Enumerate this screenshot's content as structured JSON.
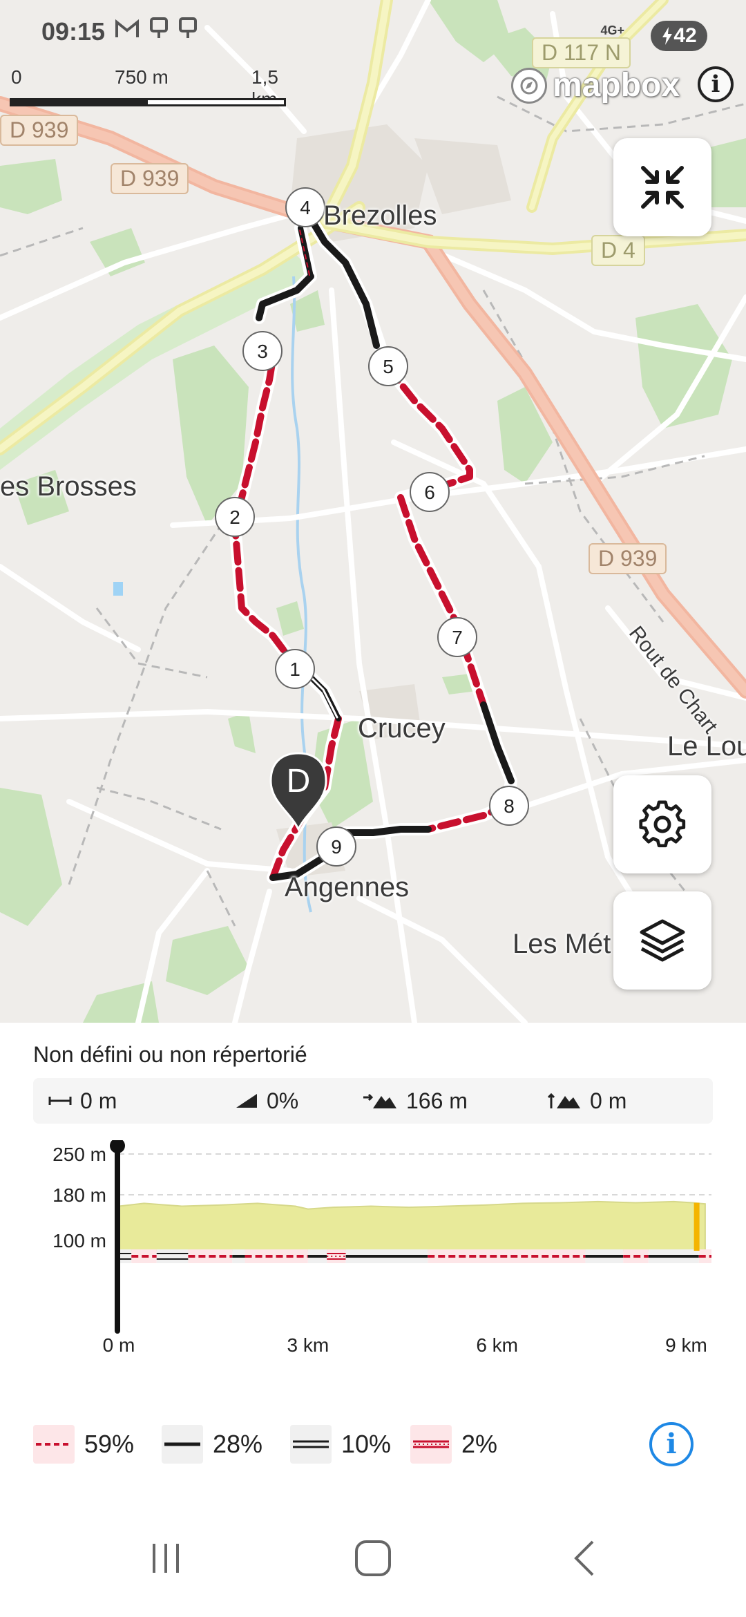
{
  "status_bar": {
    "time": "09:15",
    "network_label": "4G+",
    "battery_level": "42"
  },
  "map": {
    "scale": {
      "tick0": "0",
      "tick1": "750 m",
      "tick2": "1,5 km"
    },
    "attribution": "mapbox",
    "place_labels": {
      "brezolles": "Brezolles",
      "les_brosses": "es Brosses",
      "crucey": "Crucey",
      "angennes": "Angennes",
      "le_lou": "Le Lou",
      "les_met": "Les Mét",
      "route_de_chartres": "Rout de Chart"
    },
    "road_labels": {
      "d939_a": "D 939",
      "d939_b": "D 939",
      "d939_c": "D 939",
      "d117": "D 117 N",
      "d4": "D 4"
    },
    "waypoints": [
      "1",
      "2",
      "3",
      "4",
      "5",
      "6",
      "7",
      "8",
      "9"
    ],
    "start_marker": "D",
    "route_colors": {
      "red": "#c8102e",
      "black": "#1a1a1a",
      "outline": "#ffffff"
    }
  },
  "panel": {
    "surface_title": "Non défini ou non répertorié",
    "stats": {
      "distance": "0 m",
      "slope": "0%",
      "ascent": "166 m",
      "descent": "0 m"
    },
    "legend": [
      {
        "pct": "59%",
        "type": "dashed-red"
      },
      {
        "pct": "28%",
        "type": "solid-black"
      },
      {
        "pct": "10%",
        "type": "double-line"
      },
      {
        "pct": "2%",
        "type": "dotted-red"
      }
    ]
  },
  "chart_data": {
    "type": "area",
    "title": "",
    "xlabel": "",
    "ylabel": "",
    "y_tick_labels": [
      "250 m",
      "180 m",
      "100 m"
    ],
    "x_tick_labels": [
      "0 m",
      "3 km",
      "6 km",
      "9 km"
    ],
    "ylim": [
      60,
      250
    ],
    "xlim": [
      0,
      9.4
    ],
    "grid": true,
    "fill_color": "#e8ea9a",
    "series": [
      {
        "x": [
          0,
          0.4,
          1.0,
          1.6,
          2.2,
          2.8,
          3.0,
          3.4,
          4.0,
          4.6,
          5.2,
          5.8,
          6.4,
          7.0,
          7.6,
          8.2,
          8.8,
          9.1,
          9.3
        ],
        "values": [
          160,
          165,
          160,
          162,
          165,
          160,
          155,
          158,
          160,
          158,
          160,
          162,
          165,
          166,
          168,
          166,
          168,
          166,
          164
        ]
      }
    ],
    "cursor_x": 0,
    "end_marker_color": "#f4b400"
  }
}
